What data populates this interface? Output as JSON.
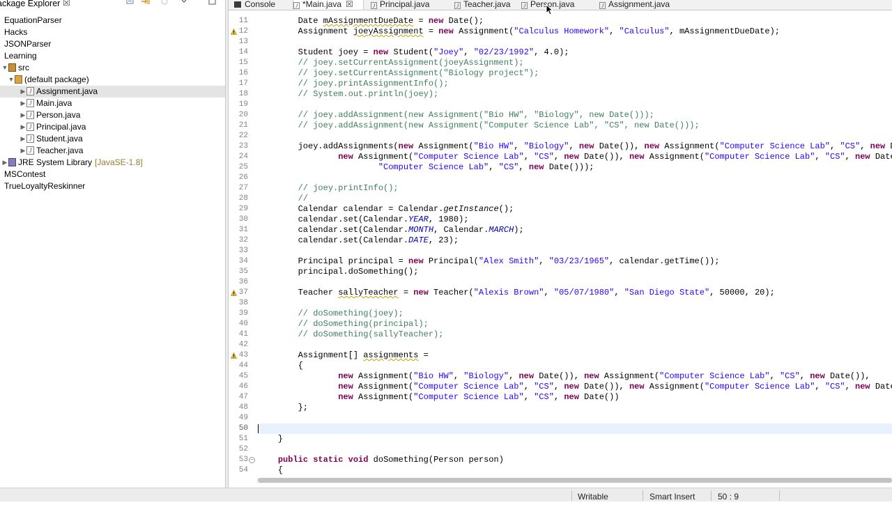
{
  "package_explorer": {
    "title": "ackage Explorer",
    "close_glyph": "☒",
    "items": [
      {
        "label": "EquationParser",
        "level": 0,
        "icon": "project"
      },
      {
        "label": "Hacks",
        "level": 0,
        "icon": "project"
      },
      {
        "label": "JSONParser",
        "level": 0,
        "icon": "project"
      },
      {
        "label": "Learning",
        "level": 0,
        "icon": "project"
      },
      {
        "label": "src",
        "level": 1,
        "icon": "src-folder"
      },
      {
        "label": "(default package)",
        "level": 2,
        "icon": "package"
      },
      {
        "label": "Assignment.java",
        "level": 3,
        "icon": "java-file",
        "selected": true
      },
      {
        "label": "Main.java",
        "level": 3,
        "icon": "java-file"
      },
      {
        "label": "Person.java",
        "level": 3,
        "icon": "java-file"
      },
      {
        "label": "Principal.java",
        "level": 3,
        "icon": "java-file"
      },
      {
        "label": "Student.java",
        "level": 3,
        "icon": "java-file"
      },
      {
        "label": "Teacher.java",
        "level": 3,
        "icon": "java-file"
      },
      {
        "label": "JRE System Library",
        "decoration": "[JavaSE-1.8]",
        "level": 1,
        "icon": "library"
      },
      {
        "label": "MSContest",
        "level": 0,
        "icon": "project"
      },
      {
        "label": "TrueLoyaltyReskinner",
        "level": 0,
        "icon": "project"
      }
    ]
  },
  "editor_tabs": [
    {
      "label": "Console",
      "icon": "console"
    },
    {
      "label": "*Main.java",
      "icon": "java",
      "active": true,
      "close": "☒"
    },
    {
      "label": "Principal.java",
      "icon": "java"
    },
    {
      "label": "Teacher.java",
      "icon": "java"
    },
    {
      "label": "Person.java",
      "icon": "java"
    },
    {
      "label": "Assignment.java",
      "icon": "java"
    }
  ],
  "editor": {
    "current_line": 50,
    "lines": [
      {
        "n": 11,
        "segs": [
          [
            "t",
            "        Date "
          ],
          [
            "u",
            "mAssignmentDueDate"
          ],
          [
            "t",
            " = "
          ],
          [
            "k",
            "new"
          ],
          [
            "t",
            " Date();"
          ]
        ]
      },
      {
        "n": 12,
        "warn": true,
        "segs": [
          [
            "t",
            "        Assignment "
          ],
          [
            "u",
            "joeyAssignment"
          ],
          [
            "t",
            " = "
          ],
          [
            "k",
            "new"
          ],
          [
            "t",
            " Assignment("
          ],
          [
            "s",
            "\"Calculus Homework\""
          ],
          [
            "t",
            ", "
          ],
          [
            "s",
            "\"Calculus\""
          ],
          [
            "t",
            ", mAssignmentDueDate);"
          ]
        ]
      },
      {
        "n": 13,
        "segs": []
      },
      {
        "n": 14,
        "segs": [
          [
            "t",
            "        Student joey = "
          ],
          [
            "k",
            "new"
          ],
          [
            "t",
            " Student("
          ],
          [
            "s",
            "\"Joey\""
          ],
          [
            "t",
            ", "
          ],
          [
            "s",
            "\"02/23/1992\""
          ],
          [
            "t",
            ", 4.0);"
          ]
        ]
      },
      {
        "n": 15,
        "segs": [
          [
            "c",
            "        // joey.setCurrentAssignment(joeyAssignment);"
          ]
        ]
      },
      {
        "n": 16,
        "segs": [
          [
            "c",
            "        // joey.setCurrentAssignment(\"Biology project\");"
          ]
        ]
      },
      {
        "n": 17,
        "segs": [
          [
            "c",
            "        // joey.printAssignmentInfo();"
          ]
        ]
      },
      {
        "n": 18,
        "segs": [
          [
            "c",
            "        // System.out.println(joey);"
          ]
        ]
      },
      {
        "n": 19,
        "segs": []
      },
      {
        "n": 20,
        "segs": [
          [
            "c",
            "        // joey.addAssignment(new Assignment(\"Bio HW\", \"Biology\", new Date()));"
          ]
        ]
      },
      {
        "n": 21,
        "segs": [
          [
            "c",
            "        // joey.addAssignment(new Assignment(\"Computer Science Lab\", \"CS\", new Date()));"
          ]
        ]
      },
      {
        "n": 22,
        "segs": []
      },
      {
        "n": 23,
        "segs": [
          [
            "t",
            "        joey.addAssignments("
          ],
          [
            "k",
            "new"
          ],
          [
            "t",
            " Assignment("
          ],
          [
            "s",
            "\"Bio HW\""
          ],
          [
            "t",
            ", "
          ],
          [
            "s",
            "\"Biology\""
          ],
          [
            "t",
            ", "
          ],
          [
            "k",
            "new"
          ],
          [
            "t",
            " Date()), "
          ],
          [
            "k",
            "new"
          ],
          [
            "t",
            " Assignment("
          ],
          [
            "s",
            "\"Computer Science Lab\""
          ],
          [
            "t",
            ", "
          ],
          [
            "s",
            "\"CS\""
          ],
          [
            "t",
            ", "
          ],
          [
            "k",
            "new"
          ],
          [
            "t",
            " Date"
          ]
        ]
      },
      {
        "n": 24,
        "segs": [
          [
            "t",
            "                "
          ],
          [
            "k",
            "new"
          ],
          [
            "t",
            " Assignment("
          ],
          [
            "s",
            "\"Computer Science Lab\""
          ],
          [
            "t",
            ", "
          ],
          [
            "s",
            "\"CS\""
          ],
          [
            "t",
            ", "
          ],
          [
            "k",
            "new"
          ],
          [
            "t",
            " Date()), "
          ],
          [
            "k",
            "new"
          ],
          [
            "t",
            " Assignment("
          ],
          [
            "s",
            "\"Computer Science Lab\""
          ],
          [
            "t",
            ", "
          ],
          [
            "s",
            "\"CS\""
          ],
          [
            "t",
            ", "
          ],
          [
            "k",
            "new"
          ],
          [
            "t",
            " Date())"
          ]
        ]
      },
      {
        "n": 25,
        "segs": [
          [
            "t",
            "                        "
          ],
          [
            "s",
            "\"Computer Science Lab\""
          ],
          [
            "t",
            ", "
          ],
          [
            "s",
            "\"CS\""
          ],
          [
            "t",
            ", "
          ],
          [
            "k",
            "new"
          ],
          [
            "t",
            " Date()));"
          ]
        ]
      },
      {
        "n": 26,
        "segs": []
      },
      {
        "n": 27,
        "segs": [
          [
            "c",
            "        // joey.printInfo();"
          ]
        ]
      },
      {
        "n": 28,
        "segs": [
          [
            "c",
            "        //"
          ]
        ]
      },
      {
        "n": 29,
        "segs": [
          [
            "t",
            "        Calendar calendar = Calendar."
          ],
          [
            "i",
            "getInstance"
          ],
          [
            "t",
            "();"
          ]
        ]
      },
      {
        "n": 30,
        "segs": [
          [
            "t",
            "        calendar.set(Calendar."
          ],
          [
            "f",
            "YEAR"
          ],
          [
            "t",
            ", 1980);"
          ]
        ]
      },
      {
        "n": 31,
        "segs": [
          [
            "t",
            "        calendar.set(Calendar."
          ],
          [
            "f",
            "MONTH"
          ],
          [
            "t",
            ", Calendar."
          ],
          [
            "f",
            "MARCH"
          ],
          [
            "t",
            ");"
          ]
        ]
      },
      {
        "n": 32,
        "segs": [
          [
            "t",
            "        calendar.set(Calendar."
          ],
          [
            "f",
            "DATE"
          ],
          [
            "t",
            ", 23);"
          ]
        ]
      },
      {
        "n": 33,
        "segs": []
      },
      {
        "n": 34,
        "segs": [
          [
            "t",
            "        Principal principal = "
          ],
          [
            "k",
            "new"
          ],
          [
            "t",
            " Principal("
          ],
          [
            "s",
            "\"Alex Smith\""
          ],
          [
            "t",
            ", "
          ],
          [
            "s",
            "\"03/23/1965\""
          ],
          [
            "t",
            ", calendar.getTime());"
          ]
        ]
      },
      {
        "n": 35,
        "segs": [
          [
            "t",
            "        principal.doSomething();"
          ]
        ]
      },
      {
        "n": 36,
        "segs": []
      },
      {
        "n": 37,
        "warn": true,
        "segs": [
          [
            "t",
            "        Teacher "
          ],
          [
            "u",
            "sallyTeacher"
          ],
          [
            "t",
            " = "
          ],
          [
            "k",
            "new"
          ],
          [
            "t",
            " Teacher("
          ],
          [
            "s",
            "\"Alexis Brown\""
          ],
          [
            "t",
            ", "
          ],
          [
            "s",
            "\"05/07/1980\""
          ],
          [
            "t",
            ", "
          ],
          [
            "s",
            "\"San Diego State\""
          ],
          [
            "t",
            ", 50000, 20);"
          ]
        ]
      },
      {
        "n": 38,
        "segs": []
      },
      {
        "n": 39,
        "segs": [
          [
            "c",
            "        // doSomething(joey);"
          ]
        ]
      },
      {
        "n": 40,
        "segs": [
          [
            "c",
            "        // doSomething(principal);"
          ]
        ]
      },
      {
        "n": 41,
        "segs": [
          [
            "c",
            "        // doSomething(sallyTeacher);"
          ]
        ]
      },
      {
        "n": 42,
        "segs": []
      },
      {
        "n": 43,
        "warn": true,
        "segs": [
          [
            "t",
            "        Assignment[] "
          ],
          [
            "u",
            "assignments"
          ],
          [
            "t",
            " ="
          ]
        ]
      },
      {
        "n": 44,
        "segs": [
          [
            "t",
            "        {"
          ]
        ]
      },
      {
        "n": 45,
        "segs": [
          [
            "t",
            "                "
          ],
          [
            "k",
            "new"
          ],
          [
            "t",
            " Assignment("
          ],
          [
            "s",
            "\"Bio HW\""
          ],
          [
            "t",
            ", "
          ],
          [
            "s",
            "\"Biology\""
          ],
          [
            "t",
            ", "
          ],
          [
            "k",
            "new"
          ],
          [
            "t",
            " Date()), "
          ],
          [
            "k",
            "new"
          ],
          [
            "t",
            " Assignment("
          ],
          [
            "s",
            "\"Computer Science Lab\""
          ],
          [
            "t",
            ", "
          ],
          [
            "s",
            "\"CS\""
          ],
          [
            "t",
            ", "
          ],
          [
            "k",
            "new"
          ],
          [
            "t",
            " Date()),"
          ]
        ]
      },
      {
        "n": 46,
        "segs": [
          [
            "t",
            "                "
          ],
          [
            "k",
            "new"
          ],
          [
            "t",
            " Assignment("
          ],
          [
            "s",
            "\"Computer Science Lab\""
          ],
          [
            "t",
            ", "
          ],
          [
            "s",
            "\"CS\""
          ],
          [
            "t",
            ", "
          ],
          [
            "k",
            "new"
          ],
          [
            "t",
            " Date()), "
          ],
          [
            "k",
            "new"
          ],
          [
            "t",
            " Assignment("
          ],
          [
            "s",
            "\"Computer Science Lab\""
          ],
          [
            "t",
            ", "
          ],
          [
            "s",
            "\"CS\""
          ],
          [
            "t",
            ", "
          ],
          [
            "k",
            "new"
          ],
          [
            "t",
            " Date())"
          ]
        ]
      },
      {
        "n": 47,
        "segs": [
          [
            "t",
            "                "
          ],
          [
            "k",
            "new"
          ],
          [
            "t",
            " Assignment("
          ],
          [
            "s",
            "\"Computer Science Lab\""
          ],
          [
            "t",
            ", "
          ],
          [
            "s",
            "\"CS\""
          ],
          [
            "t",
            ", "
          ],
          [
            "k",
            "new"
          ],
          [
            "t",
            " Date())"
          ]
        ]
      },
      {
        "n": 48,
        "segs": [
          [
            "t",
            "        };"
          ]
        ]
      },
      {
        "n": 49,
        "segs": []
      },
      {
        "n": 50,
        "segs": [
          [
            "t",
            "        "
          ]
        ]
      },
      {
        "n": 51,
        "segs": [
          [
            "t",
            "    }"
          ]
        ]
      },
      {
        "n": 52,
        "segs": []
      },
      {
        "n": 53,
        "fold": true,
        "segs": [
          [
            "t",
            "    "
          ],
          [
            "k",
            "public"
          ],
          [
            "t",
            " "
          ],
          [
            "k",
            "static"
          ],
          [
            "t",
            " "
          ],
          [
            "k",
            "void"
          ],
          [
            "t",
            " doSomething(Person person)"
          ]
        ]
      },
      {
        "n": 54,
        "segs": [
          [
            "t",
            "    {"
          ]
        ]
      }
    ]
  },
  "status_bar": {
    "mode": "Writable",
    "insert_mode": "Smart Insert",
    "position": "50 : 9"
  }
}
